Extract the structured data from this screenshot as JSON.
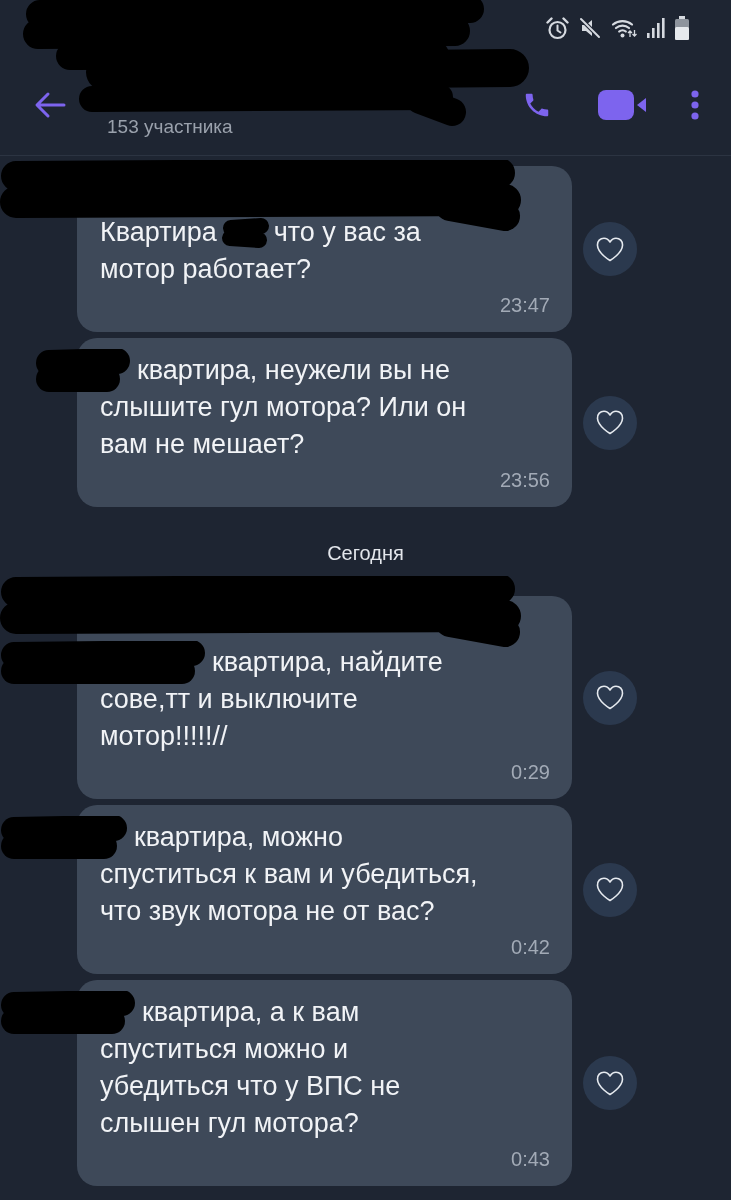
{
  "header": {
    "title_redacted": true,
    "subtitle": "153 участника"
  },
  "chat": [
    {
      "kind": "message",
      "sender_redacted": true,
      "number_redacted": true,
      "lead": "Квартира",
      "lines": [
        "что у вас за",
        "мотор работает?"
      ],
      "time": "23:47",
      "liked": false
    },
    {
      "kind": "message",
      "sender_redacted": false,
      "number_redacted": true,
      "lines": [
        "квартира, неужели вы не",
        "слышите гул мотора? Или он",
        "вам не мешает?"
      ],
      "time": "23:56",
      "liked": false
    },
    {
      "kind": "date",
      "label": "Сегодня"
    },
    {
      "kind": "message",
      "sender_redacted": true,
      "number_redacted": true,
      "lines": [
        "квартира, найдите",
        "сове,тт и выключите",
        "мотор!!!!!//"
      ],
      "time": "0:29",
      "liked": false
    },
    {
      "kind": "message",
      "sender_redacted": false,
      "number_redacted": true,
      "lines": [
        "квартира, можно",
        "спуститься к вам и убедиться,",
        "что звук мотора не от вас?"
      ],
      "time": "0:42",
      "liked": false
    },
    {
      "kind": "message",
      "sender_redacted": false,
      "number_redacted": true,
      "lines": [
        "квартира, а к вам",
        "спуститься можно и",
        "убедиться что у ВПС не",
        "слышен гул мотора?"
      ],
      "time": "0:43",
      "liked": false
    }
  ]
}
